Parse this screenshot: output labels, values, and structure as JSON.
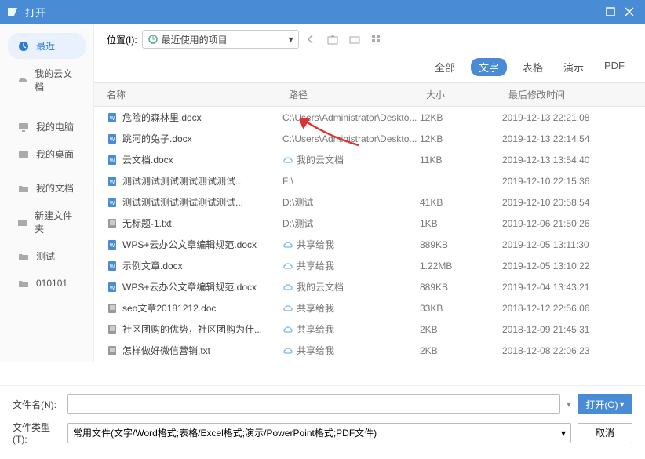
{
  "window": {
    "title": "打开"
  },
  "sidebar": {
    "items": [
      {
        "label": "最近",
        "icon": "clock"
      },
      {
        "label": "我的云文档",
        "icon": "cloud"
      },
      {
        "label": "我的电脑",
        "icon": "monitor"
      },
      {
        "label": "我的桌面",
        "icon": "desktop"
      },
      {
        "label": "我的文档",
        "icon": "folder"
      },
      {
        "label": "新建文件夹",
        "icon": "folder"
      },
      {
        "label": "测试",
        "icon": "folder"
      },
      {
        "label": "010101",
        "icon": "folder"
      }
    ]
  },
  "location": {
    "label": "位置(I):",
    "value": "最近使用的项目"
  },
  "filters": {
    "tabs": [
      "全部",
      "文字",
      "表格",
      "演示",
      "PDF"
    ],
    "active": 1
  },
  "columns": {
    "name": "名称",
    "path": "路径",
    "size": "大小",
    "date": "最后修改时间"
  },
  "files": [
    {
      "name": "危险的森林里.docx",
      "icon": "docx",
      "cloud": false,
      "path": "C:\\Users\\Administrator\\Deskto...",
      "size": "12KB",
      "date": "2019-12-13 22:21:08"
    },
    {
      "name": "跳河的兔子.docx",
      "icon": "docx",
      "cloud": false,
      "path": "C:\\Users\\Administrator\\Deskto...",
      "size": "12KB",
      "date": "2019-12-13 22:14:54"
    },
    {
      "name": "云文档.docx",
      "icon": "docx",
      "cloud": true,
      "path": "我的云文档",
      "size": "11KB",
      "date": "2019-12-13 13:54:40"
    },
    {
      "name": "测试测试测试测试测试测试...",
      "icon": "docx",
      "cloud": false,
      "path": "F:\\",
      "size": "",
      "date": "2019-12-10 22:15:36"
    },
    {
      "name": "测试测试测试测试测试测试...",
      "icon": "docx",
      "cloud": false,
      "path": "D:\\测试",
      "size": "41KB",
      "date": "2019-12-10 20:58:54"
    },
    {
      "name": "无标题-1.txt",
      "icon": "txt",
      "cloud": false,
      "path": "D:\\测试",
      "size": "1KB",
      "date": "2019-12-06 21:50:26"
    },
    {
      "name": "WPS+云办公文章编辑规范.docx",
      "icon": "docx",
      "cloud": true,
      "path": "共享给我",
      "size": "889KB",
      "date": "2019-12-05 13:11:30"
    },
    {
      "name": "示例文章.docx",
      "icon": "docx",
      "cloud": true,
      "path": "共享给我",
      "size": "1.22MB",
      "date": "2019-12-05 13:10:22"
    },
    {
      "name": "WPS+云办公文章编辑规范.docx",
      "icon": "docx",
      "cloud": true,
      "path": "我的云文档",
      "size": "889KB",
      "date": "2019-12-04 13:43:21"
    },
    {
      "name": "seo文章20181212.doc",
      "icon": "txt",
      "cloud": true,
      "path": "共享给我",
      "size": "33KB",
      "date": "2018-12-12 22:56:06"
    },
    {
      "name": "社区团购的优势，社区团购为什...",
      "icon": "txt",
      "cloud": true,
      "path": "共享给我",
      "size": "2KB",
      "date": "2018-12-09 21:45:31"
    },
    {
      "name": "怎样做好微信营销.txt",
      "icon": "txt",
      "cloud": true,
      "path": "共享给我",
      "size": "2KB",
      "date": "2018-12-08 22:06:23"
    }
  ],
  "footer": {
    "filename_label": "文件名(N):",
    "filetype_label": "文件类型(T):",
    "filetype_value": "常用文件(文字/Word格式;表格/Excel格式;演示/PowerPoint格式;PDF文件)",
    "open_btn": "打开(O)",
    "cancel_btn": "取消"
  }
}
